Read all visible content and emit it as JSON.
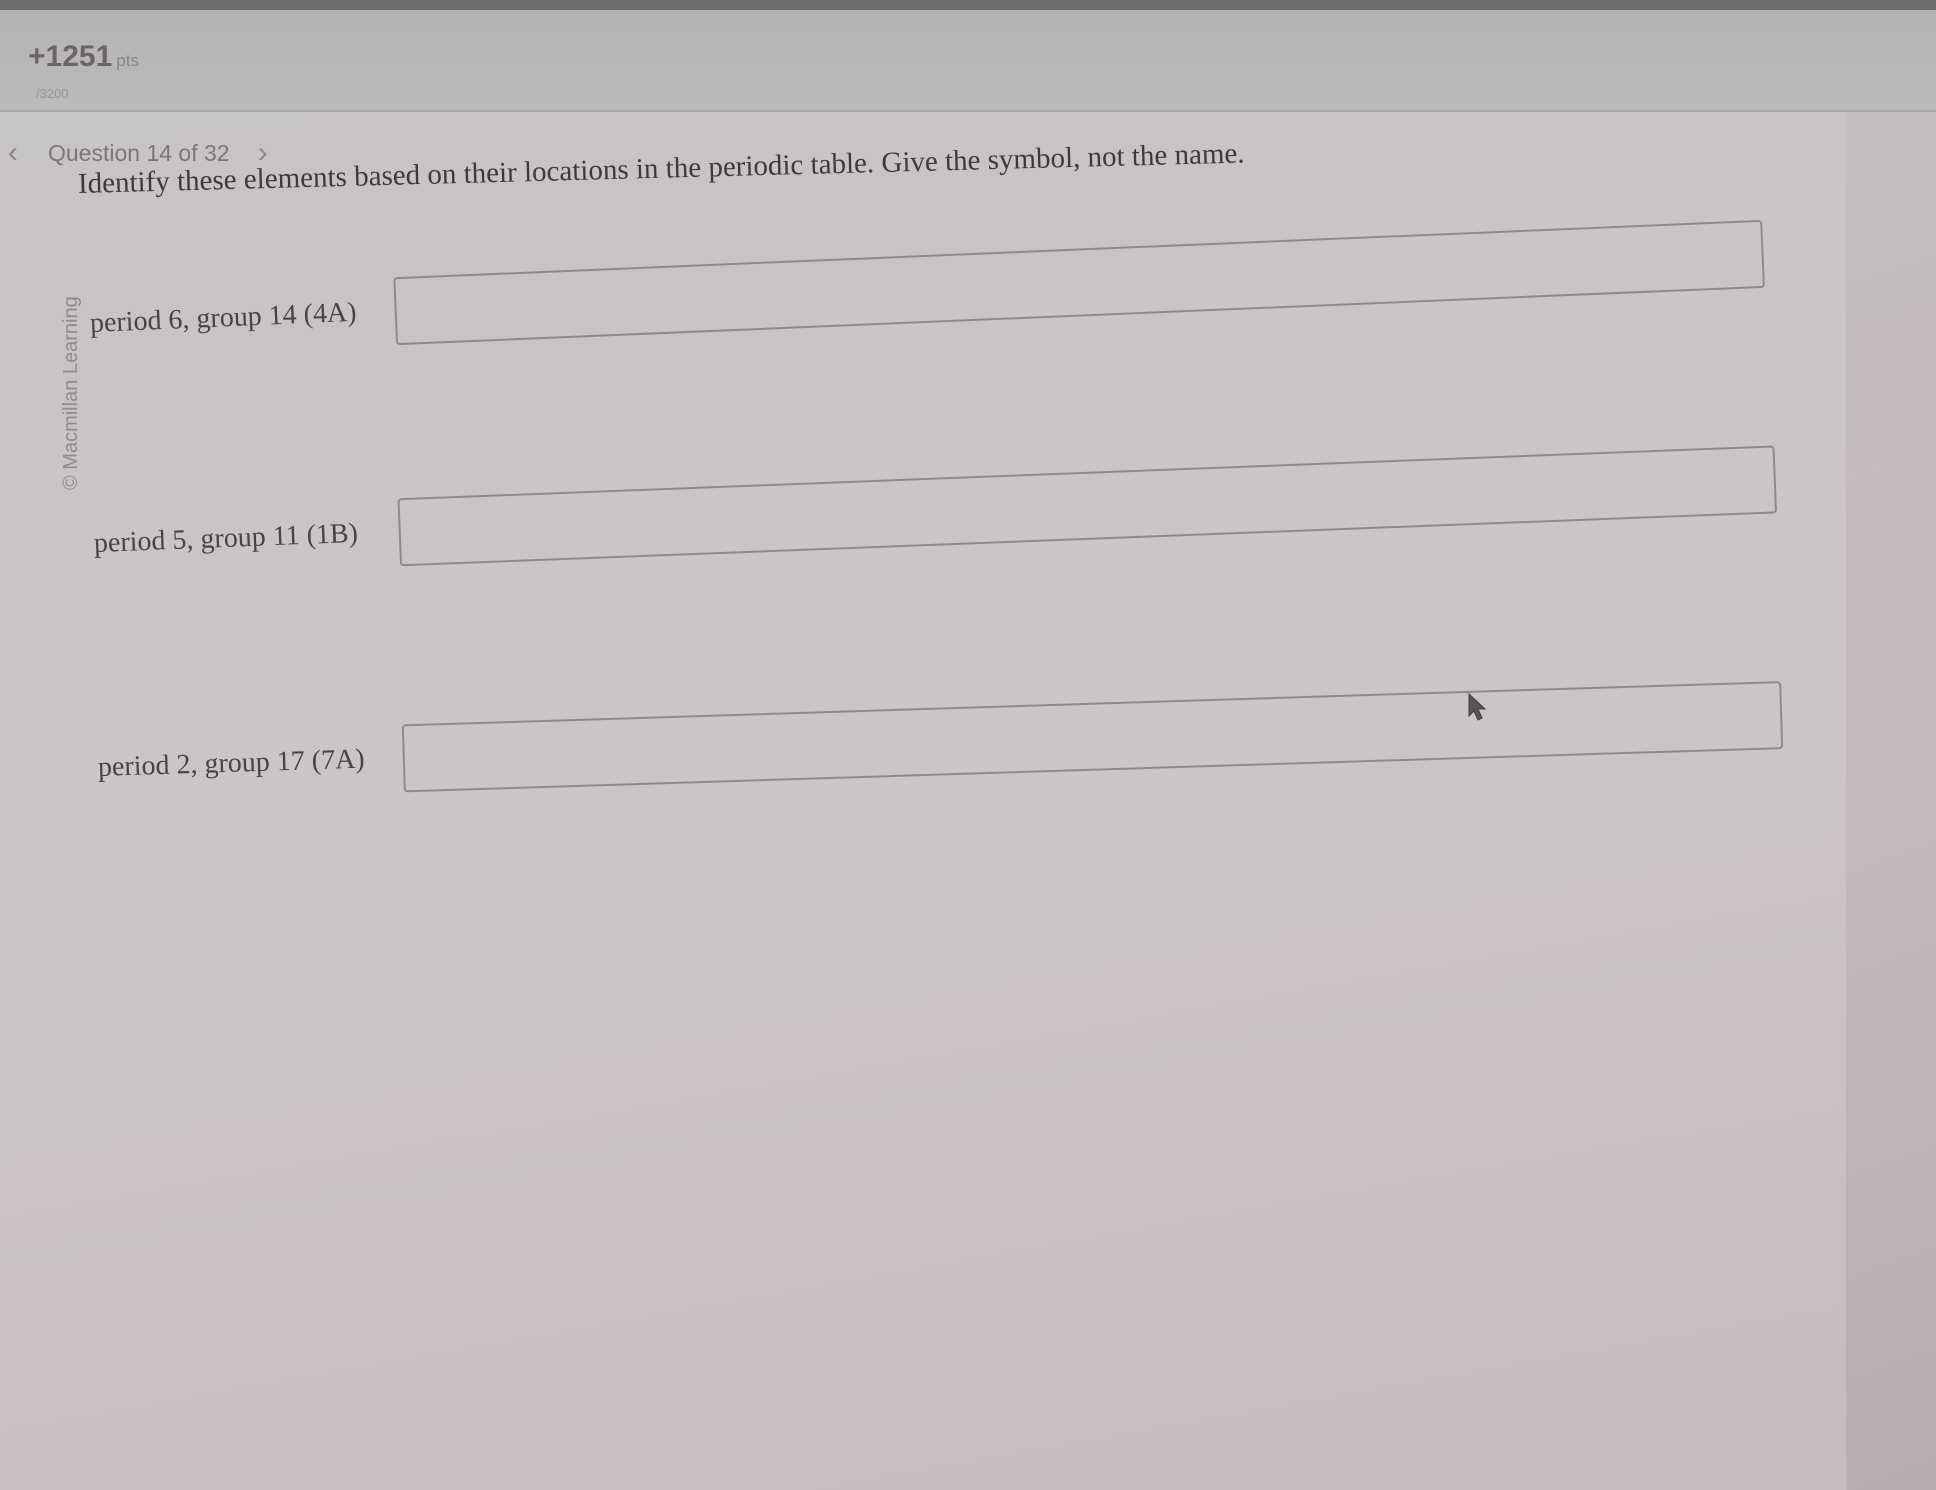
{
  "header": {
    "score": "+1251",
    "score_unit": "pts",
    "score_sub": "/3200"
  },
  "nav": {
    "question_label": "Question 14 of 32",
    "prev_icon": "chevron-left-icon",
    "next_icon": "chevron-right-icon"
  },
  "watermark": "© Macmillan Learning",
  "instructions": "Identify these elements based on their locations in the periodic table. Give the symbol, not the name.",
  "questions": [
    {
      "label": "period 6, group 14 (4A)",
      "value": ""
    },
    {
      "label": "period 5, group 11 (1B)",
      "value": ""
    },
    {
      "label": "period 2, group 17 (7A)",
      "value": ""
    }
  ],
  "colors": {
    "background": "#c4bec0",
    "text": "#4a4346",
    "input_border": "#8f898b"
  }
}
